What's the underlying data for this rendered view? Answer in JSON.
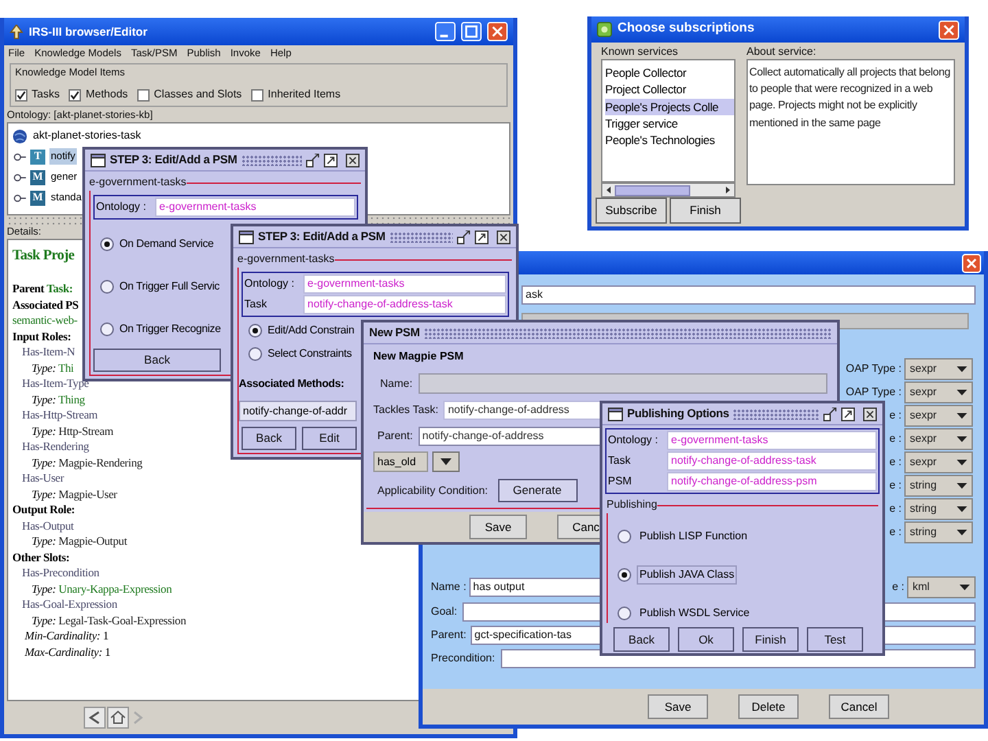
{
  "main_window": {
    "title": "IRS-III browser/Editor",
    "menu": [
      "File",
      "Knowledge Models",
      "Task/PSM",
      "Publish",
      "Invoke",
      "Help"
    ],
    "items_group": {
      "title": "Knowledge Model Items",
      "checkboxes": [
        {
          "label": "Tasks",
          "checked": true
        },
        {
          "label": "Methods",
          "checked": true
        },
        {
          "label": "Classes and Slots",
          "checked": false
        },
        {
          "label": "Inherited Items",
          "checked": false
        }
      ]
    },
    "ontology_label": "Ontology: [akt-planet-stories-kb]",
    "tree": [
      {
        "kind": "ontology",
        "label": "akt-planet-stories-task",
        "selected": false,
        "children": [
          {
            "kind": "task",
            "badge": "T",
            "label": "notify",
            "selected": true
          },
          {
            "kind": "method",
            "badge": "M",
            "label": "gener",
            "selected": false
          },
          {
            "kind": "method",
            "badge": "M",
            "label": "standa",
            "selected": false
          }
        ]
      }
    ],
    "details_label": "Details:",
    "details": {
      "title": "Task Proje",
      "parent_label": "Parent",
      "parent_value": "Task:",
      "associated": "Associated PS",
      "method_link": "semantic-web-",
      "sections": [
        {
          "heading": "Input Roles:",
          "slots": [
            {
              "name": "Has-Item-N",
              "type_label": "Type:",
              "type": "Thi",
              "linked": true
            },
            {
              "name": "Has-Item-Type",
              "type_label": "Type:",
              "type": "Thing",
              "linked": true
            },
            {
              "name": "Has-Http-Stream",
              "type_label": "Type:",
              "type": "Http-Stream",
              "linked": false
            },
            {
              "name": "Has-Rendering",
              "type_label": "Type:",
              "type": "Magpie-Rendering",
              "linked": false
            },
            {
              "name": "Has-User",
              "type_label": "Type:",
              "type": "Magpie-User",
              "linked": false
            }
          ]
        },
        {
          "heading": "Output Role:",
          "slots": [
            {
              "name": "Has-Output",
              "type_label": "Type:",
              "type": "Magpie-Output",
              "linked": false
            }
          ]
        },
        {
          "heading": "Other Slots:",
          "slots": [
            {
              "name": "Has-Precondition",
              "type_label": "Type:",
              "type": "Unary-Kappa-Expression",
              "linked": true
            },
            {
              "name": "Has-Goal-Expression",
              "type_label": "Type:",
              "type": "Legal-Task-Goal-Expression",
              "linked": false
            }
          ]
        }
      ],
      "cardinalities": [
        {
          "label": "Min-Cardinality:",
          "value": "1"
        },
        {
          "label": "Max-Cardinality:",
          "value": "1"
        }
      ]
    }
  },
  "subscriptions_window": {
    "title": "Choose subscriptions",
    "known_label": "Known services",
    "services": [
      {
        "label": "People Collector",
        "selected": false
      },
      {
        "label": "Project Collector",
        "selected": false
      },
      {
        "label": "People's Projects Colle",
        "selected": true
      },
      {
        "label": "Trigger service",
        "selected": false
      },
      {
        "label": "People's Technologies",
        "selected": false
      }
    ],
    "about_label": "About service:",
    "about_text": "Collect automatically all projects that belong to people that were recognized in a web page. Projects might not be explicitly mentioned in the same page",
    "buttons": [
      "Subscribe",
      "Finish"
    ]
  },
  "task_editor_window": {
    "field_1": "ask",
    "types": [
      {
        "label": "OAP Type :",
        "value": "sexpr"
      },
      {
        "label": "OAP Type :",
        "value": "sexpr"
      },
      {
        "label": "e :",
        "value": "sexpr"
      },
      {
        "label": "e :",
        "value": "sexpr"
      },
      {
        "label": "e :",
        "value": "sexpr"
      },
      {
        "label": "e :",
        "value": "string"
      },
      {
        "label": "e :",
        "value": "string"
      },
      {
        "label": "e :",
        "value": "string"
      }
    ],
    "name_label": "Name :",
    "name_value": "has output",
    "name_type": {
      "label": "e :",
      "value": "kml"
    },
    "goal_label": "Goal:",
    "parent_label": "Parent:",
    "parent_value": "gct-specification-tas",
    "precondition_label": "Precondition:",
    "buttons": [
      "Save",
      "Delete",
      "Cancel"
    ]
  },
  "step3_windows": [
    {
      "title": "STEP 3: Edit/Add a PSM",
      "group": "e-government-tasks",
      "ontology_label": "Ontology :",
      "ontology": "e-government-tasks",
      "options": [
        {
          "label": "On Demand Service",
          "selected": true
        },
        {
          "label": "On Trigger Full Servic",
          "selected": false
        },
        {
          "label": "On Trigger Recognize",
          "selected": false
        }
      ],
      "buttons": [
        "Back"
      ]
    },
    {
      "title": "STEP 3: Edit/Add a PSM",
      "group": "e-government-tasks",
      "ontology_label": "Ontology :",
      "ontology": "e-government-tasks",
      "task_label": "Task",
      "task": "notify-change-of-address-task",
      "options": [
        {
          "label": "Edit/Add Constrain",
          "selected": true
        },
        {
          "label": "Select Constraints",
          "selected": false
        }
      ],
      "methods_label": "Associated Methods:",
      "methods": [
        "notify-change-of-addr"
      ],
      "buttons": [
        "Back",
        "Edit"
      ]
    }
  ],
  "new_psm_window": {
    "title": "New PSM",
    "heading": "New Magpie PSM",
    "name_label": "Name:",
    "tackles_label": "Tackles Task:",
    "tackles_value": "notify-change-of-address",
    "parent_label": "Parent:",
    "parent_value": "notify-change-of-address",
    "slot_value": "has_old",
    "applicability_label": "Applicability Condition:",
    "generate_button": "Generate",
    "buttons": [
      "Save",
      "Canc"
    ]
  },
  "publishing_window": {
    "title": "Publishing Options",
    "ontology_label": "Ontology :",
    "ontology": "e-government-tasks",
    "task_label": "Task",
    "task": "notify-change-of-address-task",
    "psm_label": "PSM",
    "psm": "notify-change-of-address-psm",
    "group": "Publishing",
    "options": [
      {
        "label": "Publish LISP Function",
        "selected": false
      },
      {
        "label": "Publish JAVA Class",
        "selected": true
      },
      {
        "label": "Publish WSDL Service",
        "selected": false
      }
    ],
    "buttons": [
      "Back",
      "Ok",
      "Finish",
      "Test"
    ]
  }
}
